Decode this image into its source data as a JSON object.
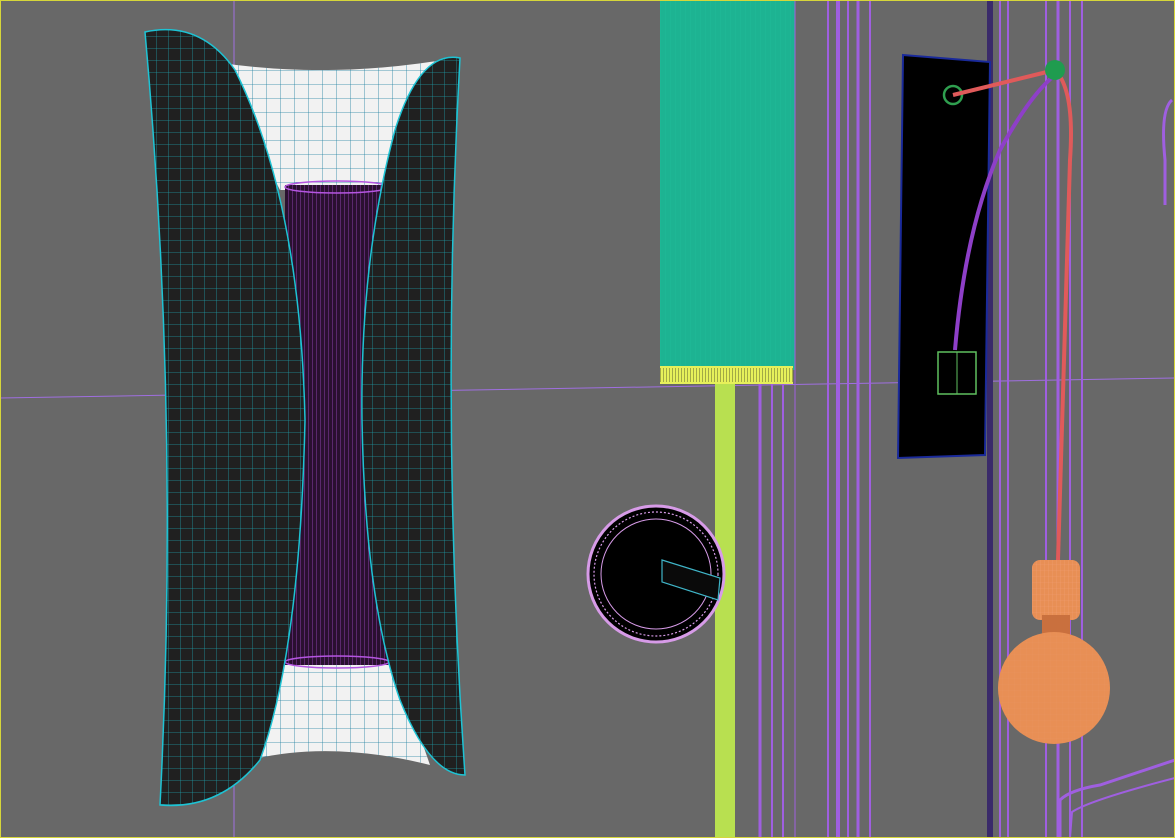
{
  "viewport": {
    "background": "#686868",
    "border_color": "#d6d63a",
    "grid_line_color": "#9f6fe0"
  },
  "objects": [
    {
      "id": "sconce-left",
      "kind": "wall-sconce-mesh",
      "shell_color": "#202020",
      "wire_color": "#1ec3d4",
      "inner_color": "#2a1030",
      "inner_wire": "#b455e0",
      "cap_color": "#f2f2f2"
    },
    {
      "id": "cylinder-lamp",
      "kind": "cylinder",
      "color": "#1db392",
      "ring_color": "#e6f05a",
      "rod_color": "#b8e050"
    },
    {
      "id": "knob",
      "kind": "round-knob",
      "color": "#000000",
      "rim_color": "#d79be8"
    },
    {
      "id": "wall-plate",
      "kind": "backplate",
      "color": "#000000",
      "edge_color": "#1a2a9a"
    },
    {
      "id": "pendant-bulb",
      "kind": "bulb",
      "color": "#e88f55",
      "socket_color": "#e88f55",
      "cord_color": "#e05a5a"
    }
  ]
}
